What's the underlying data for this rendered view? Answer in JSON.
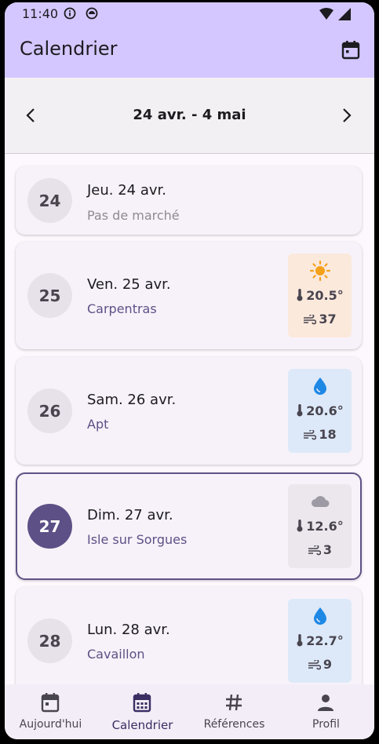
{
  "status": {
    "time": "11:40"
  },
  "app": {
    "title": "Calendrier"
  },
  "range": {
    "label": "24 avr. - 4 mai"
  },
  "days": [
    {
      "num": "24",
      "name": "Jeu. 24 avr.",
      "market": "Pas de marché"
    },
    {
      "num": "25",
      "name": "Ven. 25 avr.",
      "market": "Carpentras",
      "weather": {
        "icon": "sun-icon",
        "temp": "20.5°",
        "wind": "37",
        "bg": "#fbe9dc"
      }
    },
    {
      "num": "26",
      "name": "Sam. 26 avr.",
      "market": "Apt",
      "weather": {
        "icon": "water-drop-icon",
        "temp": "20.6°",
        "wind": "18",
        "bg": "#dde9f9"
      }
    },
    {
      "num": "27",
      "name": "Dim. 27 avr.",
      "market": "Isle sur Sorgues",
      "selected": true,
      "weather": {
        "icon": "cloud-icon",
        "temp": "12.6°",
        "wind": "3",
        "bg": "#ebe7ed"
      }
    },
    {
      "num": "28",
      "name": "Lun. 28 avr.",
      "market": "Cavaillon",
      "weather": {
        "icon": "water-drop-icon",
        "temp": "22.7°",
        "wind": "9",
        "bg": "#dde9f9"
      }
    }
  ],
  "nav": [
    {
      "label": "Aujourd'hui",
      "icon": "calendar-today-icon"
    },
    {
      "label": "Calendrier",
      "icon": "calendar-month-icon",
      "active": true
    },
    {
      "label": "Références",
      "icon": "hash-icon"
    },
    {
      "label": "Profil",
      "icon": "person-icon"
    }
  ],
  "colors": {
    "accent": "#5d5086",
    "appbar": "#d4c7ff"
  }
}
